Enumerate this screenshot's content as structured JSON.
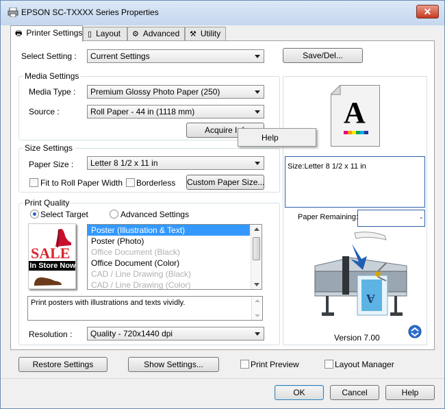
{
  "window": {
    "title": "EPSON SC-TXXXX Series Properties",
    "close": "✕"
  },
  "tabs": [
    {
      "label": "Printer Settings",
      "icon": "printer-icon"
    },
    {
      "label": "Layout",
      "icon": "page-layout-icon"
    },
    {
      "label": "Advanced",
      "icon": "gear-icon"
    },
    {
      "label": "Utility",
      "icon": "wrench-icon"
    }
  ],
  "select_setting": {
    "label": "Select Setting :",
    "value": "Current Settings",
    "save_button": "Save/Del..."
  },
  "media_settings": {
    "title": "Media Settings",
    "media_type_label": "Media Type :",
    "media_type_value": "Premium Glossy Photo Paper (250)",
    "source_label": "Source :",
    "source_value": "Roll Paper - 44 in (1118 mm)",
    "acquire_button": "Acquire Info..."
  },
  "context_menu": {
    "item": "Help"
  },
  "size_settings": {
    "title": "Size Settings",
    "paper_size_label": "Paper Size :",
    "paper_size_value": "Letter 8 1/2 x 11 in",
    "fit_roll_label": "Fit to Roll Paper Width",
    "borderless_label": "Borderless",
    "custom_button": "Custom Paper Size..."
  },
  "print_quality": {
    "title": "Print Quality",
    "select_target": "Select Target",
    "advanced_settings": "Advanced Settings",
    "targets": [
      {
        "label": "Poster (Illustration & Text)",
        "state": "selected"
      },
      {
        "label": "Poster (Photo)",
        "state": "normal"
      },
      {
        "label": "Office Document (Black)",
        "state": "disabled"
      },
      {
        "label": "Office Document (Color)",
        "state": "normal"
      },
      {
        "label": "CAD / Line Drawing (Black)",
        "state": "disabled"
      },
      {
        "label": "CAD / Line Drawing (Color)",
        "state": "disabled"
      }
    ],
    "description": "Print posters with illustrations and texts vividly.",
    "resolution_label": "Resolution :",
    "resolution_value": "Quality - 720x1440 dpi",
    "sale_text": "SALE",
    "in_store_text": "In Store Now"
  },
  "preview": {
    "page_letter": "A",
    "size_text": "Size:Letter 8 1/2 x 11 in",
    "paper_remaining_label": "Paper Remaining:",
    "paper_remaining_value": "-",
    "printout_letter": "A",
    "version": "Version 7.00"
  },
  "bottom": {
    "restore": "Restore Settings",
    "show": "Show Settings...",
    "print_preview": "Print Preview",
    "layout_manager": "Layout Manager"
  },
  "dialog": {
    "ok": "OK",
    "cancel": "Cancel",
    "help": "Help"
  },
  "colors": {
    "selection": "#3399ff",
    "title_bar": "#dbe8f7",
    "close": "#c43b20"
  }
}
